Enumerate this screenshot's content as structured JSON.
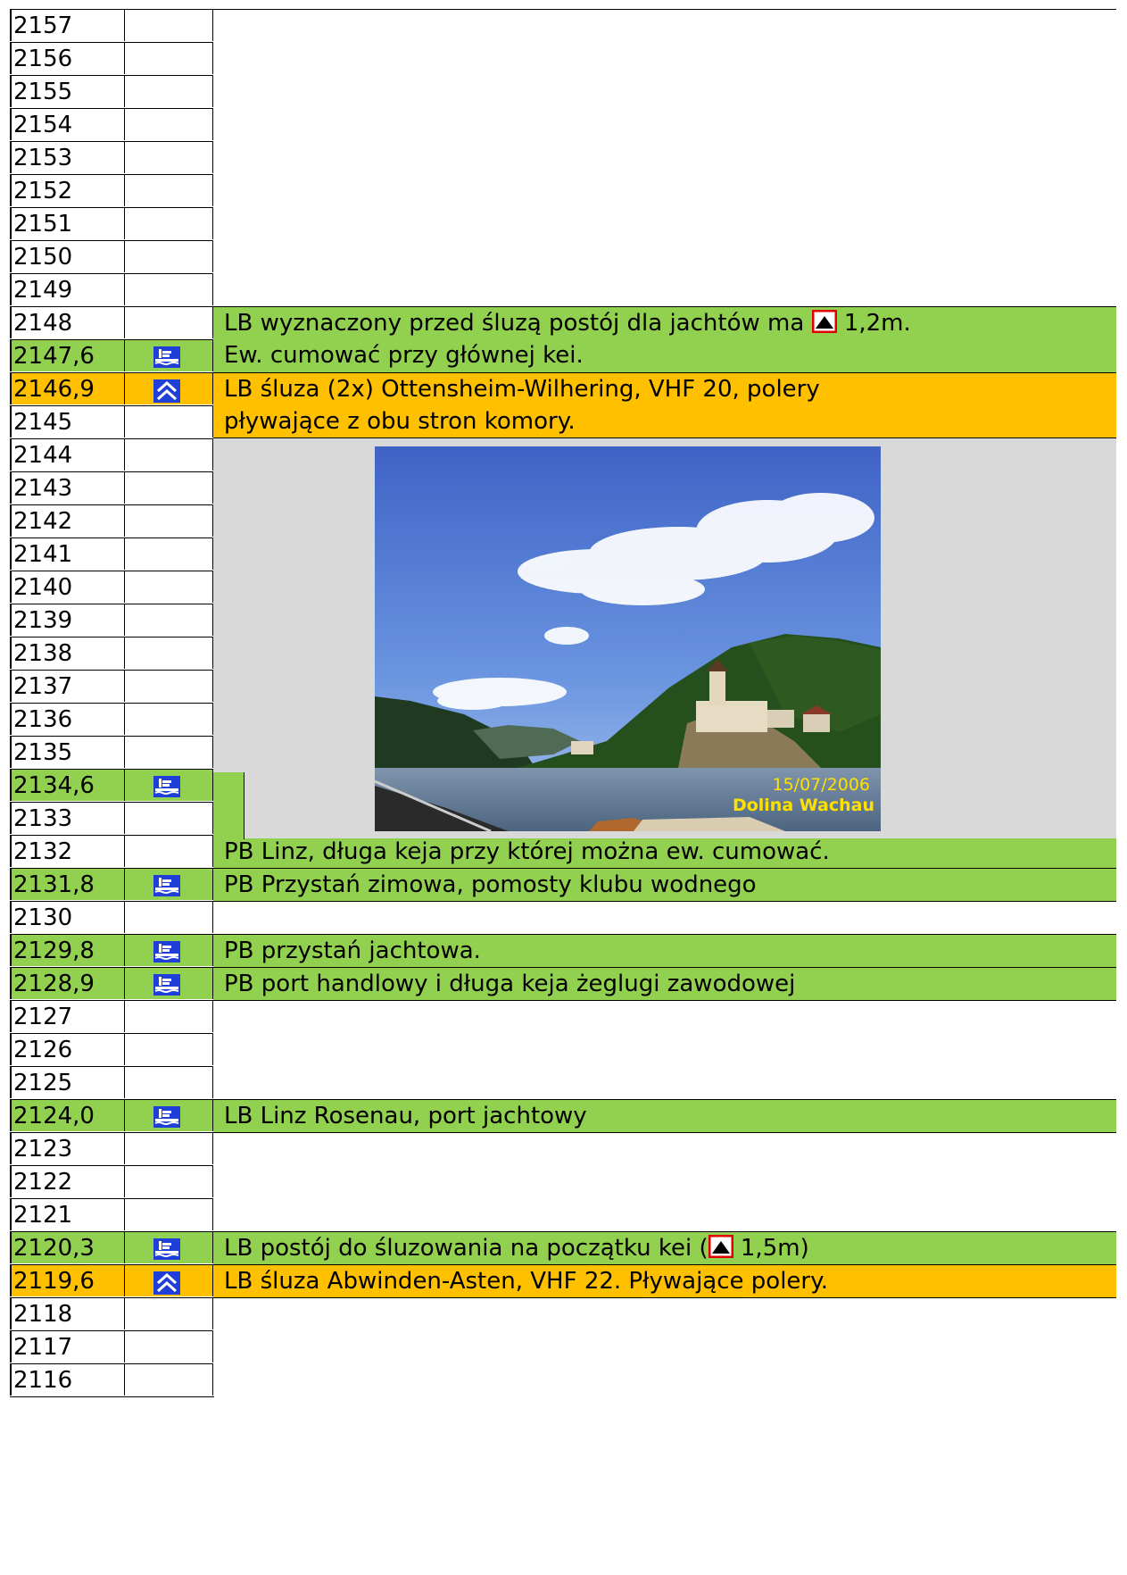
{
  "rows": [
    {
      "km": "2157",
      "bg": "white",
      "icon": ""
    },
    {
      "km": "2156",
      "bg": "white",
      "icon": ""
    },
    {
      "km": "2155",
      "bg": "white",
      "icon": ""
    },
    {
      "km": "2154",
      "bg": "white",
      "icon": ""
    },
    {
      "km": "2153",
      "bg": "white",
      "icon": ""
    },
    {
      "km": "2152",
      "bg": "white",
      "icon": ""
    },
    {
      "km": "2151",
      "bg": "white",
      "icon": ""
    },
    {
      "km": "2150",
      "bg": "white",
      "icon": ""
    },
    {
      "km": "2149",
      "bg": "white",
      "icon": ""
    },
    {
      "km": "2148",
      "bg": "white",
      "icon": ""
    },
    {
      "km": "2147,6",
      "bg": "green",
      "icon": "marina-icon"
    },
    {
      "km": "2146,9",
      "bg": "orange",
      "icon": "lock-icon"
    },
    {
      "km": "2145",
      "bg": "white",
      "icon": ""
    },
    {
      "km": "2144",
      "bg": "white",
      "icon": ""
    },
    {
      "km": "2143",
      "bg": "white",
      "icon": ""
    },
    {
      "km": "2142",
      "bg": "white",
      "icon": ""
    },
    {
      "km": "2141",
      "bg": "white",
      "icon": ""
    },
    {
      "km": "2140",
      "bg": "white",
      "icon": ""
    },
    {
      "km": "2139",
      "bg": "white",
      "icon": ""
    },
    {
      "km": "2138",
      "bg": "white",
      "icon": ""
    },
    {
      "km": "2137",
      "bg": "white",
      "icon": ""
    },
    {
      "km": "2136",
      "bg": "white",
      "icon": ""
    },
    {
      "km": "2135",
      "bg": "white",
      "icon": ""
    },
    {
      "km": "2134,6",
      "bg": "green",
      "icon": "marina-icon"
    },
    {
      "km": "2133",
      "bg": "white",
      "icon": ""
    },
    {
      "km": "2132",
      "bg": "white",
      "icon": ""
    },
    {
      "km": "2131,8",
      "bg": "green",
      "icon": "marina-icon"
    },
    {
      "km": "2130",
      "bg": "white",
      "icon": ""
    },
    {
      "km": "2129,8",
      "bg": "green",
      "icon": "marina-icon"
    },
    {
      "km": "2128,9",
      "bg": "green",
      "icon": "marina-icon"
    },
    {
      "km": "2127",
      "bg": "white",
      "icon": ""
    },
    {
      "km": "2126",
      "bg": "white",
      "icon": ""
    },
    {
      "km": "2125",
      "bg": "white",
      "icon": ""
    },
    {
      "km": "2124,0",
      "bg": "green",
      "icon": "marina-icon"
    },
    {
      "km": "2123",
      "bg": "white",
      "icon": ""
    },
    {
      "km": "2122",
      "bg": "white",
      "icon": ""
    },
    {
      "km": "2121",
      "bg": "white",
      "icon": ""
    },
    {
      "km": "2120,3",
      "bg": "green",
      "icon": "marina-icon"
    },
    {
      "km": "2119,6",
      "bg": "orange",
      "icon": "lock-icon"
    },
    {
      "km": "2118",
      "bg": "white",
      "icon": ""
    },
    {
      "km": "2117",
      "bg": "white",
      "icon": ""
    },
    {
      "km": "2116",
      "bg": "white",
      "icon": ""
    }
  ],
  "descriptions": {
    "d1_line1_pre": "LB wyznaczony przed śluzą postój dla jachtów ma",
    "d1_line1_post": "1,2m.",
    "d1_line2": "Ew. cumować przy głównej kei.",
    "d2_line1": "LB śluza (2x) Ottensheim-Wilhering, VHF 20, polery",
    "d2_line2": "pływające z obu stron komory.",
    "d3": "PB Linz, długa keja przy której można ew. cumować.",
    "d4": "PB Przystań zimowa, pomosty klubu wodnego",
    "d5": "PB przystań jachtowa.",
    "d6": "PB port handlowy i długa keja żeglugi zawodowej",
    "d7": "LB Linz Rosenau, port jachtowy",
    "d8_pre": "LB postój do śluzowania na początku kei (",
    "d8_post": "1,5m)",
    "d9": "LB śluza Abwinden-Asten, VHF 22. Pływające polery."
  },
  "photo": {
    "date": "15/07/2006",
    "caption": "Dolina Wachau"
  },
  "colors": {
    "green": "#92d050",
    "orange": "#ffc000",
    "gray": "#d9d9d9",
    "icon_blue": "#1f3fd8"
  }
}
